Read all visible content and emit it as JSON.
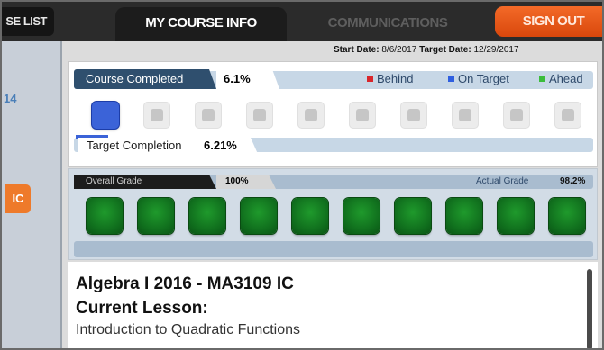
{
  "nav": {
    "course_list": "SE LIST",
    "my_course_info": "MY COURSE INFO",
    "communications": "COMMUNICATIONS",
    "sign_out": "SIGN OUT"
  },
  "sidebar": {
    "number": "14",
    "button": "IC"
  },
  "dates": {
    "start_label": "Start Date:",
    "start_value": "8/6/2017",
    "target_label": "Target Date:",
    "target_value": "12/29/2017"
  },
  "course": {
    "completed_label": "Course Completed",
    "completed_pct": "6.1%",
    "legend": [
      {
        "label": "Behind",
        "color": "#d9262b"
      },
      {
        "label": "On Target",
        "color": "#2f5fe0"
      },
      {
        "label": "Ahead",
        "color": "#3bbd3b"
      }
    ],
    "progress_squares_total": 10,
    "current_square_index": 0,
    "target_label": "Target Completion",
    "target_pct": "6.21%",
    "target_fraction": 0.0621
  },
  "grade": {
    "overall_label": "Overall Grade",
    "overall_pct": "100%",
    "actual_label": "Actual Grade",
    "actual_value": "98.2%",
    "green_squares_total": 10
  },
  "lesson": {
    "title": "Algebra I 2016 - MA3109 IC",
    "current_label": "Current Lesson:",
    "name": "Introduction to Quadratic Functions"
  },
  "colors": {
    "accent_orange": "#e8561a",
    "header_dark": "#2f4f6e",
    "on_target_blue": "#3b63d8",
    "grade_green": "#137a22"
  }
}
